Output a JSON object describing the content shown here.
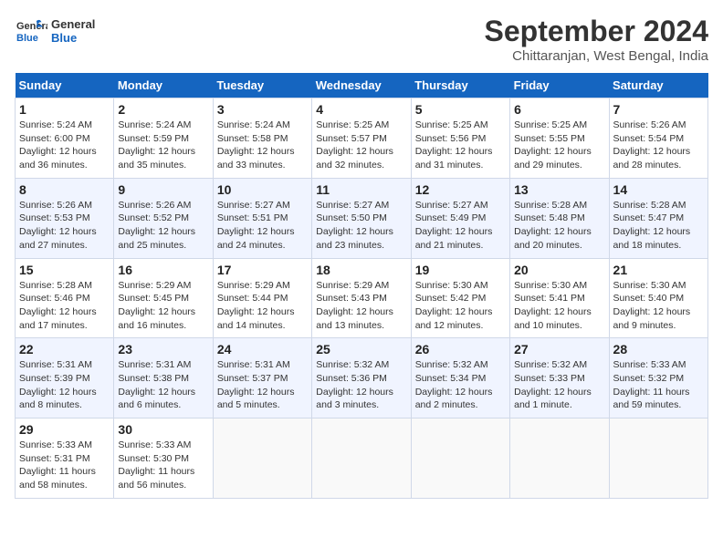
{
  "header": {
    "logo_line1": "General",
    "logo_line2": "Blue",
    "month": "September 2024",
    "location": "Chittaranjan, West Bengal, India"
  },
  "weekdays": [
    "Sunday",
    "Monday",
    "Tuesday",
    "Wednesday",
    "Thursday",
    "Friday",
    "Saturday"
  ],
  "weeks": [
    [
      {
        "day": "1",
        "info": "Sunrise: 5:24 AM\nSunset: 6:00 PM\nDaylight: 12 hours\nand 36 minutes."
      },
      {
        "day": "2",
        "info": "Sunrise: 5:24 AM\nSunset: 5:59 PM\nDaylight: 12 hours\nand 35 minutes."
      },
      {
        "day": "3",
        "info": "Sunrise: 5:24 AM\nSunset: 5:58 PM\nDaylight: 12 hours\nand 33 minutes."
      },
      {
        "day": "4",
        "info": "Sunrise: 5:25 AM\nSunset: 5:57 PM\nDaylight: 12 hours\nand 32 minutes."
      },
      {
        "day": "5",
        "info": "Sunrise: 5:25 AM\nSunset: 5:56 PM\nDaylight: 12 hours\nand 31 minutes."
      },
      {
        "day": "6",
        "info": "Sunrise: 5:25 AM\nSunset: 5:55 PM\nDaylight: 12 hours\nand 29 minutes."
      },
      {
        "day": "7",
        "info": "Sunrise: 5:26 AM\nSunset: 5:54 PM\nDaylight: 12 hours\nand 28 minutes."
      }
    ],
    [
      {
        "day": "8",
        "info": "Sunrise: 5:26 AM\nSunset: 5:53 PM\nDaylight: 12 hours\nand 27 minutes."
      },
      {
        "day": "9",
        "info": "Sunrise: 5:26 AM\nSunset: 5:52 PM\nDaylight: 12 hours\nand 25 minutes."
      },
      {
        "day": "10",
        "info": "Sunrise: 5:27 AM\nSunset: 5:51 PM\nDaylight: 12 hours\nand 24 minutes."
      },
      {
        "day": "11",
        "info": "Sunrise: 5:27 AM\nSunset: 5:50 PM\nDaylight: 12 hours\nand 23 minutes."
      },
      {
        "day": "12",
        "info": "Sunrise: 5:27 AM\nSunset: 5:49 PM\nDaylight: 12 hours\nand 21 minutes."
      },
      {
        "day": "13",
        "info": "Sunrise: 5:28 AM\nSunset: 5:48 PM\nDaylight: 12 hours\nand 20 minutes."
      },
      {
        "day": "14",
        "info": "Sunrise: 5:28 AM\nSunset: 5:47 PM\nDaylight: 12 hours\nand 18 minutes."
      }
    ],
    [
      {
        "day": "15",
        "info": "Sunrise: 5:28 AM\nSunset: 5:46 PM\nDaylight: 12 hours\nand 17 minutes."
      },
      {
        "day": "16",
        "info": "Sunrise: 5:29 AM\nSunset: 5:45 PM\nDaylight: 12 hours\nand 16 minutes."
      },
      {
        "day": "17",
        "info": "Sunrise: 5:29 AM\nSunset: 5:44 PM\nDaylight: 12 hours\nand 14 minutes."
      },
      {
        "day": "18",
        "info": "Sunrise: 5:29 AM\nSunset: 5:43 PM\nDaylight: 12 hours\nand 13 minutes."
      },
      {
        "day": "19",
        "info": "Sunrise: 5:30 AM\nSunset: 5:42 PM\nDaylight: 12 hours\nand 12 minutes."
      },
      {
        "day": "20",
        "info": "Sunrise: 5:30 AM\nSunset: 5:41 PM\nDaylight: 12 hours\nand 10 minutes."
      },
      {
        "day": "21",
        "info": "Sunrise: 5:30 AM\nSunset: 5:40 PM\nDaylight: 12 hours\nand 9 minutes."
      }
    ],
    [
      {
        "day": "22",
        "info": "Sunrise: 5:31 AM\nSunset: 5:39 PM\nDaylight: 12 hours\nand 8 minutes."
      },
      {
        "day": "23",
        "info": "Sunrise: 5:31 AM\nSunset: 5:38 PM\nDaylight: 12 hours\nand 6 minutes."
      },
      {
        "day": "24",
        "info": "Sunrise: 5:31 AM\nSunset: 5:37 PM\nDaylight: 12 hours\nand 5 minutes."
      },
      {
        "day": "25",
        "info": "Sunrise: 5:32 AM\nSunset: 5:36 PM\nDaylight: 12 hours\nand 3 minutes."
      },
      {
        "day": "26",
        "info": "Sunrise: 5:32 AM\nSunset: 5:34 PM\nDaylight: 12 hours\nand 2 minutes."
      },
      {
        "day": "27",
        "info": "Sunrise: 5:32 AM\nSunset: 5:33 PM\nDaylight: 12 hours\nand 1 minute."
      },
      {
        "day": "28",
        "info": "Sunrise: 5:33 AM\nSunset: 5:32 PM\nDaylight: 11 hours\nand 59 minutes."
      }
    ],
    [
      {
        "day": "29",
        "info": "Sunrise: 5:33 AM\nSunset: 5:31 PM\nDaylight: 11 hours\nand 58 minutes."
      },
      {
        "day": "30",
        "info": "Sunrise: 5:33 AM\nSunset: 5:30 PM\nDaylight: 11 hours\nand 56 minutes."
      },
      {
        "day": "",
        "info": ""
      },
      {
        "day": "",
        "info": ""
      },
      {
        "day": "",
        "info": ""
      },
      {
        "day": "",
        "info": ""
      },
      {
        "day": "",
        "info": ""
      }
    ]
  ]
}
